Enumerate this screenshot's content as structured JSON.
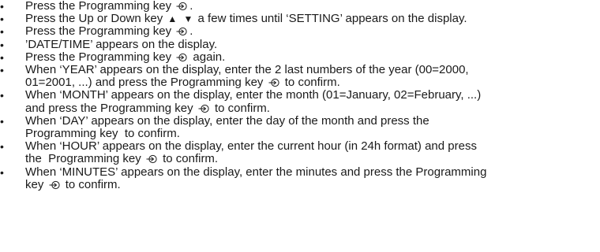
{
  "bullet": "•",
  "icons": {
    "programming_key": "programming-key-icon",
    "up_arrow": "▲",
    "down_arrow": "▼"
  },
  "steps": [
    {
      "a": "Press the Programming key",
      "b": "."
    },
    {
      "a": "Press the Up or Down key",
      "b": "a few times until ‘SETTING’ appears on the display."
    },
    {
      "a": "Press the Programming key",
      "b": "."
    },
    {
      "a": "’DATE/TIME’ appears on the display."
    },
    {
      "a": "Press the Programming key",
      "b": "again."
    },
    {
      "a": "When ‘YEAR’ appears on the display, enter the 2 last numbers of the year (00=2000,\n01=2001, ...) and press the Programming key",
      "b": "to confirm."
    },
    {
      "a": "When ‘MONTH’ appears on the display, enter the month (01=January, 02=February, ...)\nand press the Programming key",
      "b": "to confirm."
    },
    {
      "a": "When ‘DAY’ appears on the display, enter the day of the month and press the\nProgramming key  to confirm."
    },
    {
      "a": "When ‘HOUR’ appears on the display, enter the current hour (in 24h format) and press\nthe  Programming key",
      "b": "to confirm."
    },
    {
      "a": "When ‘MINUTES’ appears on the display, enter the minutes and press the Programming\nkey",
      "b": "to confirm."
    }
  ]
}
